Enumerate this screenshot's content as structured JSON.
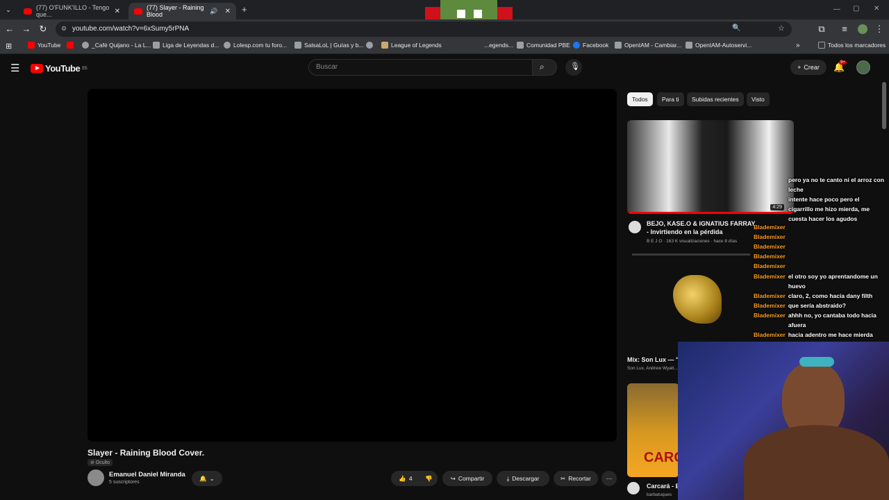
{
  "browser": {
    "tabs": [
      {
        "title": "(77) O'FUNK'ILLO - Tengo que..."
      },
      {
        "title": "(77) Slayer - Raining Blood"
      }
    ],
    "url": "youtube.com/watch?v=6xSumy5rPNA",
    "bookmarks": [
      "YouTube",
      "_Café Quijano - La L...",
      "Liga de Leyendas d...",
      "Lolesp.com tu foro...",
      "SalsaLoL | Guías y b...",
      "League of Legends",
      "...egends...",
      "Comunidad PBE",
      "Facebook",
      "OpenIAM - Cambiar...",
      "OpenIAM-Autoservi..."
    ],
    "all_bookmarks": "Todos los marcadores"
  },
  "yt": {
    "logo": "YouTube",
    "region": "ES",
    "search_placeholder": "Buscar",
    "create": "Crear",
    "notif_count": "9+"
  },
  "video": {
    "title": "Slayer - Raining Blood Cover.",
    "visibility": "Oculto",
    "channel": "Emanuel Daniel Miranda",
    "subscribers": "5 suscriptores",
    "likes": "4",
    "share": "Compartir",
    "download": "Descargar",
    "clip": "Recortar"
  },
  "chips": [
    "Todos",
    "Para ti",
    "Subidas recientes",
    "Visto"
  ],
  "recs": [
    {
      "title": "BEJO, KASE.O & IGNATIUS FARRAY - Invirtiendo en la pérdida",
      "meta": "B E J O · 163 K visualizaciones · hace 8 días",
      "duration": "4:29"
    },
    {
      "title": "Mix: Son Lux — \"T",
      "meta": "Son Lux, Andrew Wyatt..."
    },
    {
      "title": "Carcará - E",
      "meta": "barbatuques",
      "thumb_text": "CARC"
    }
  ],
  "chat": [
    {
      "user": "",
      "msg": "pero ya no te canto ni el arroz con leche"
    },
    {
      "user": "",
      "msg": "intente hace poco pero el cigarrillo me hizo mierda, me cuesta hacer los agudos"
    },
    {
      "user": "Blademixer",
      "msg": ""
    },
    {
      "user": "Blademixer",
      "msg": ""
    },
    {
      "user": "Blademixer",
      "msg": ""
    },
    {
      "user": "Blademixer",
      "msg": ""
    },
    {
      "user": "Blademixer",
      "msg": ""
    },
    {
      "user": "Blademixer",
      "msg": "el otro soy yo aprentandome un huevo"
    },
    {
      "user": "Blademixer",
      "msg": "claro, 2, como hacia dany filth"
    },
    {
      "user": "Blademixer",
      "msg": "que sería abstraido?"
    },
    {
      "user": "Blademixer",
      "msg": "ahhh no, yo cantaba todo hacia afuera"
    },
    {
      "user": "Blademixer",
      "msg": "hacia adentro me hace mierda"
    }
  ]
}
